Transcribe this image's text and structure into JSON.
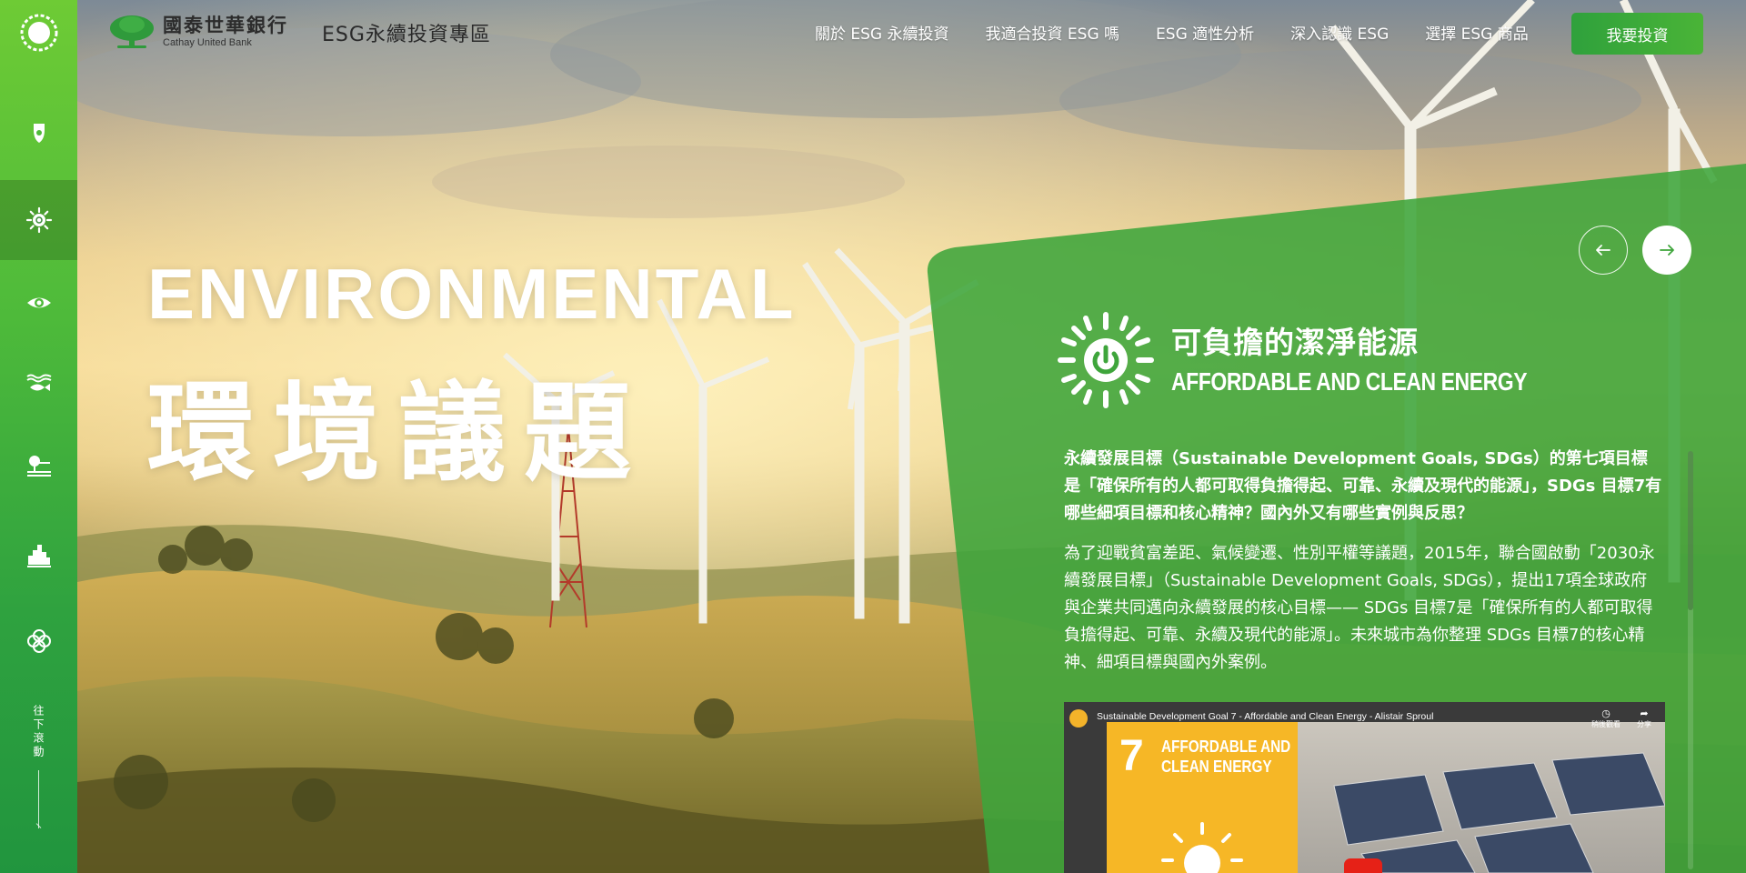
{
  "header": {
    "bank_name_zh": "國泰世華銀行",
    "bank_name_en": "Cathay United Bank",
    "site_title": "ESG永續投資專區",
    "nav": [
      {
        "label": "關於 ESG 永續投資"
      },
      {
        "label": "我適合投資 ESG 嗎"
      },
      {
        "label": "ESG 適性分析"
      },
      {
        "label": "深入認識 ESG"
      },
      {
        "label": "選擇 ESG 商品"
      }
    ],
    "invest_button": "我要投資"
  },
  "sidebar": {
    "items": [
      {
        "icon": "water-drop-icon",
        "active": false
      },
      {
        "icon": "sun-energy-icon",
        "active": true
      },
      {
        "icon": "earth-eye-icon",
        "active": false
      },
      {
        "icon": "fish-waves-icon",
        "active": false
      },
      {
        "icon": "tree-land-icon",
        "active": false
      },
      {
        "icon": "city-icon",
        "active": false
      },
      {
        "icon": "flower-icon",
        "active": false
      }
    ],
    "scroll_hint": "往下滾動"
  },
  "hero": {
    "title_en": "ENVIRONMENTAL",
    "title_zh": "環境議題"
  },
  "panel": {
    "sdg_title_zh": "可負擔的潔淨能源",
    "sdg_title_en": "AFFORDABLE AND CLEAN ENERGY",
    "lead": "永續發展目標（Sustainable Development Goals, SDGs）的第七項目標是「確保所有的人都可取得負擔得起、可靠、永續及現代的能源」，SDGs 目標7有哪些細項目標和核心精神？國內外又有哪些實例與反思？",
    "body": "為了迎戰貧富差距、氣候變遷、性別平權等議題，2015年，聯合國啟動「2030永續發展目標」（Sustainable Development Goals, SDGs），提出17項全球政府與企業共同邁向永續發展的核心目標—— SDGs 目標7是「確保所有的人都可取得負擔得起、可靠、永續及現代的能源」。未來城市為你整理 SDGs 目標7的核心精神、細項目標與國內外案例。",
    "video": {
      "title": "Sustainable Development Goal 7 - Affordable and Clean Energy - Alistair Sproul",
      "watch_later": "稍後觀看",
      "share": "分享",
      "card_number": "7",
      "card_label_line1": "AFFORDABLE AND",
      "card_label_line2": "CLEAN ENERGY"
    }
  },
  "colors": {
    "brand_green": "#3fae3a",
    "panel_green": "#3ea53b",
    "sidebar_top": "#6ecb35",
    "sidebar_bottom": "#21953e"
  }
}
